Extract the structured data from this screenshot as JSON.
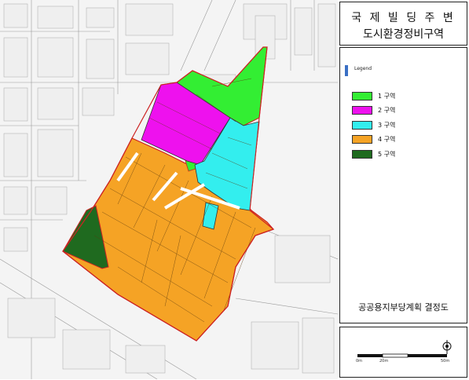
{
  "title": {
    "line1": "국 제 빌 딩 주 변",
    "line2": "도시환경정비구역"
  },
  "legend": {
    "heading": "Legend",
    "items": [
      {
        "label": "1 구역",
        "color": "#33ee33"
      },
      {
        "label": "2 구역",
        "color": "#ee11ee"
      },
      {
        "label": "3 구역",
        "color": "#33eeee"
      },
      {
        "label": "4 구역",
        "color": "#f5a325"
      },
      {
        "label": "5 구역",
        "color": "#1f6a1f"
      }
    ]
  },
  "footer": {
    "text": "공공용지부당계획 결정도"
  },
  "scale_bar": {
    "labels": [
      "0m",
      "20m",
      "50m"
    ]
  }
}
